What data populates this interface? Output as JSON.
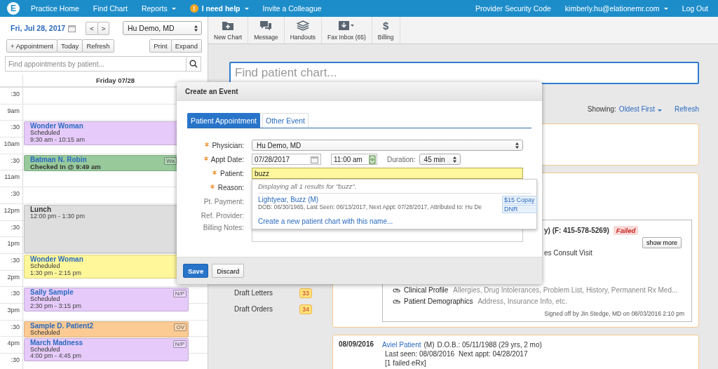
{
  "nav": {
    "logo": "E",
    "items": [
      {
        "label": "Practice Home",
        "dropdown": false
      },
      {
        "label": "Find Chart",
        "dropdown": false
      },
      {
        "label": "Reports",
        "dropdown": true
      },
      {
        "label": "I need help",
        "dropdown": true,
        "icon": "!"
      },
      {
        "label": "Invite a Colleague",
        "dropdown": false
      }
    ],
    "right_items": [
      {
        "label": "Provider Security Code",
        "dropdown": false
      },
      {
        "label": "kimberly.hu@elationemr.com",
        "dropdown": true
      },
      {
        "label": "Log Out",
        "dropdown": false
      }
    ]
  },
  "scheduler": {
    "date": "Fri, Jul 28, 2017",
    "prev": "<",
    "next": ">",
    "physician": "Hu Demo, MD",
    "buttons_left": [
      "+ Appointment",
      "Today",
      "Refresh"
    ],
    "buttons_right": [
      "Print",
      "Expand"
    ],
    "search": {
      "placeholder": "Find appointments by patient..."
    },
    "day_header": "Friday 07/28",
    "slots": [
      ":30",
      "9am",
      ":30",
      "10am",
      ":30",
      "11am",
      ":30",
      "12pm",
      ":30",
      "1pm",
      ":30",
      "2pm",
      ":30",
      "3pm",
      ":30",
      "4pm",
      ":30"
    ],
    "events": [
      {
        "kind": "appointment",
        "name": "Wonder Woman",
        "status": "Scheduled",
        "time": "9:30 am - 10:15 am",
        "color": "#e6cbfa"
      },
      {
        "kind": "checked_in",
        "name": "Batman N. Robin",
        "status": "Checked In @ 9:49 am",
        "badge": "Wa",
        "color": "#97c99b"
      },
      {
        "kind": "block",
        "name": "Lunch",
        "time": "12:00 pm - 1:30 pm",
        "color": "#dedede"
      },
      {
        "kind": "appointment",
        "name": "Wonder Woman",
        "status": "Scheduled",
        "time": "1:30 pm - 2:15 pm",
        "color": "#fff79a"
      },
      {
        "kind": "appointment",
        "name": "Sally Sample",
        "status": "Scheduled",
        "time": "2:30 pm - 3:15 pm",
        "badge": "N/P",
        "color": "#e6cbfa"
      },
      {
        "kind": "appointment",
        "name": "Sample D. Patient2",
        "status": "Scheduled",
        "badge": "OV",
        "color": "#fcca93"
      },
      {
        "kind": "appointment",
        "name": "March Madness",
        "status": "Scheduled",
        "time": "4:00 pm - 4:45 pm",
        "badge": "N/P",
        "color": "#e6cbfa"
      }
    ]
  },
  "toolbar": [
    {
      "label": "New Chart",
      "kind": "folder"
    },
    {
      "label": "Message",
      "kind": "chat"
    },
    {
      "label": "Handouts",
      "kind": "stack"
    },
    {
      "label": "Fax Inbox (65)",
      "kind": "inbox"
    },
    {
      "label": "Billing",
      "kind": "glyph",
      "glyph": "$"
    }
  ],
  "chart_search": {
    "placeholder": "Find patient chart..."
  },
  "feed_controls": {
    "label": "Showing:",
    "sort": "Oldest First",
    "refresh": "Refresh"
  },
  "drafts": [
    {
      "label": "Draft Letters",
      "count": "33"
    },
    {
      "label": "Draft Orders",
      "count": "34"
    }
  ],
  "cards": [
    {
      "kind": "empty"
    },
    {
      "kind": "signed_note",
      "fax_line": "y) (F: 415-578-5269)",
      "status": "Failed",
      "show_more": "show more",
      "visit": "es Consult Visit",
      "attachments": [
        {
          "title": "Clinical Profile",
          "detail": "Allergies, Drug Intolerances, Problem List, History, Permanent Rx Med..."
        },
        {
          "title": "Patient Demographics",
          "detail": "Address, Insurance Info, etc."
        }
      ],
      "signed": "Signed off by Jin Stedge, MD on 08/03/2016 2:10 pm"
    },
    {
      "kind": "patient",
      "date": "08/09/2016",
      "patient": "Aviel Patient",
      "sex": "(M)",
      "dob": "D.O.B.: 05/11/1988 (29 yrs, 2 mo)",
      "last_seen": "Last seen: 08/08/2016",
      "next_appt": "Next appt: 04/28/2017",
      "note": "[1 failed eRx]"
    }
  ],
  "modal": {
    "title": "Create an Event",
    "tabs": [
      {
        "label": "Patient Appointment",
        "selected": true
      },
      {
        "label": "Other Event",
        "selected": false
      }
    ],
    "fields": [
      {
        "label": "Physician:",
        "required": true,
        "kind": "select",
        "value": "Hu Demo, MD"
      },
      {
        "label": "Appt Date:",
        "required": true,
        "kind": "datetime",
        "date": "07/28/2017",
        "time": "11:00 am",
        "duration_label": "Duration:",
        "duration": "45 min"
      },
      {
        "label": "Patient:",
        "required": true,
        "kind": "search",
        "value": "buzz"
      },
      {
        "label": "Reason:",
        "required": true,
        "kind": "covered"
      },
      {
        "label": "Pt. Payment:",
        "required": false,
        "kind": "covered"
      },
      {
        "label": "Ref. Provider:",
        "required": false,
        "kind": "covered"
      },
      {
        "label": "Billing Notes:",
        "required": false,
        "kind": "textarea"
      }
    ],
    "autocomplete": {
      "message": "Displaying all 1 results for \"buzz\".",
      "results": [
        {
          "name": "Lightyear, Buzz (M)",
          "details": "DOB: 06/30/1965, Last Seen: 06/13/2017, Next Appt: 07/28/2017, Attributed to: Hu De",
          "tags": [
            "$15 Copay",
            "DNR"
          ]
        }
      ],
      "create_link": "Create a new patient chart with this name..."
    },
    "buttons": [
      {
        "label": "Save",
        "primary": true
      },
      {
        "label": "Discard",
        "primary": false
      }
    ]
  }
}
